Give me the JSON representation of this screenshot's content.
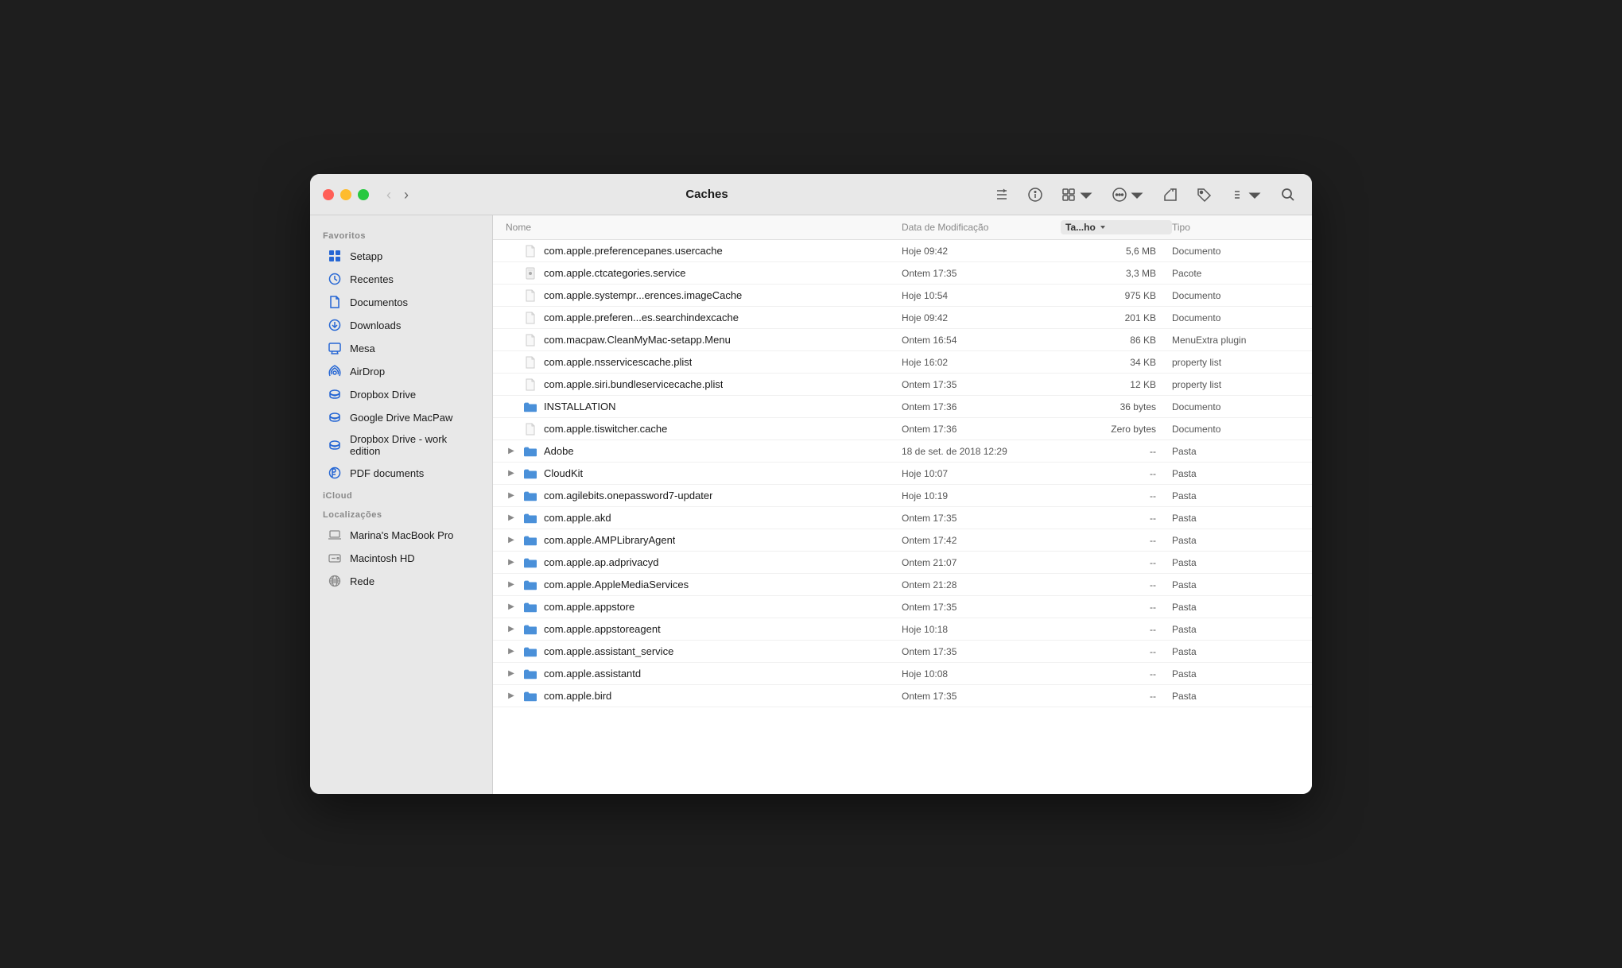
{
  "window": {
    "title": "Caches"
  },
  "toolbar": {
    "back_label": "‹",
    "forward_label": "›",
    "title": "Caches"
  },
  "sidebar": {
    "sections": [
      {
        "label": "Favoritos",
        "items": [
          {
            "id": "setapp",
            "icon": "setapp-icon",
            "label": "Setapp",
            "icon_type": "grid"
          },
          {
            "id": "recentes",
            "icon": "recent-icon",
            "label": "Recentes",
            "icon_type": "clock"
          },
          {
            "id": "documentos",
            "icon": "doc-icon",
            "label": "Documentos",
            "icon_type": "doc"
          },
          {
            "id": "downloads",
            "icon": "download-icon",
            "label": "Downloads",
            "icon_type": "arrow-down"
          },
          {
            "id": "mesa",
            "icon": "desktop-icon",
            "label": "Mesa",
            "icon_type": "monitor"
          },
          {
            "id": "airdrop",
            "icon": "airdrop-icon",
            "label": "AirDrop",
            "icon_type": "airdrop"
          },
          {
            "id": "dropbox",
            "icon": "dropbox-icon",
            "label": "Dropbox Drive",
            "icon_type": "hdd"
          },
          {
            "id": "googledrive",
            "icon": "googledrive-icon",
            "label": "Google Drive MacPaw",
            "icon_type": "hdd"
          },
          {
            "id": "dropbox-work",
            "icon": "dropbox-work-icon",
            "label": "Dropbox Drive - work edition",
            "icon_type": "hdd"
          },
          {
            "id": "pdf",
            "icon": "pdf-icon",
            "label": "PDF documents",
            "icon_type": "gear"
          }
        ]
      },
      {
        "label": "iCloud",
        "items": []
      },
      {
        "label": "Localizações",
        "items": [
          {
            "id": "macbook",
            "icon": "laptop-icon",
            "label": "Marina's MacBook Pro",
            "icon_type": "laptop"
          },
          {
            "id": "macintosh",
            "icon": "hd-icon",
            "label": "Macintosh HD",
            "icon_type": "hd"
          },
          {
            "id": "rede",
            "icon": "network-icon",
            "label": "Rede",
            "icon_type": "globe"
          }
        ]
      }
    ]
  },
  "columns": {
    "name": "Nome",
    "date": "Data de Modificação",
    "size": "Ta...ho",
    "type": "Tipo"
  },
  "files": [
    {
      "name": "com.apple.preferencepanes.usercache",
      "date": "Hoje 09:42",
      "size": "5,6 MB",
      "type": "Documento",
      "kind": "doc",
      "folder": false,
      "expandable": false
    },
    {
      "name": "com.apple.ctcategories.service",
      "date": "Ontem 17:35",
      "size": "3,3 MB",
      "type": "Pacote",
      "kind": "pkg",
      "folder": false,
      "expandable": false
    },
    {
      "name": "com.apple.systempr...erences.imageCache",
      "date": "Hoje 10:54",
      "size": "975 KB",
      "type": "Documento",
      "kind": "doc",
      "folder": false,
      "expandable": false
    },
    {
      "name": "com.apple.preferen...es.searchindexcache",
      "date": "Hoje 09:42",
      "size": "201 KB",
      "type": "Documento",
      "kind": "doc",
      "folder": false,
      "expandable": false
    },
    {
      "name": "com.macpaw.CleanMyMac-setapp.Menu",
      "date": "Ontem 16:54",
      "size": "86 KB",
      "type": "MenuExtra plugin",
      "kind": "doc",
      "folder": false,
      "expandable": false
    },
    {
      "name": "com.apple.nsservicescache.plist",
      "date": "Hoje 16:02",
      "size": "34 KB",
      "type": "property list",
      "kind": "doc",
      "folder": false,
      "expandable": false
    },
    {
      "name": "com.apple.siri.bundleservicecache.plist",
      "date": "Ontem 17:35",
      "size": "12 KB",
      "type": "property list",
      "kind": "doc",
      "folder": false,
      "expandable": false
    },
    {
      "name": "INSTALLATION",
      "date": "Ontem 17:36",
      "size": "36 bytes",
      "type": "Documento",
      "kind": "folder",
      "folder": true,
      "expandable": false
    },
    {
      "name": "com.apple.tiswitcher.cache",
      "date": "Ontem 17:36",
      "size": "Zero bytes",
      "type": "Documento",
      "kind": "doc",
      "folder": false,
      "expandable": false
    },
    {
      "name": "Adobe",
      "date": "18 de set. de 2018 12:29",
      "size": "--",
      "type": "Pasta",
      "kind": "folder",
      "folder": true,
      "expandable": true
    },
    {
      "name": "CloudKit",
      "date": "Hoje 10:07",
      "size": "--",
      "type": "Pasta",
      "kind": "folder",
      "folder": true,
      "expandable": true
    },
    {
      "name": "com.agilebits.onepassword7-updater",
      "date": "Hoje 10:19",
      "size": "--",
      "type": "Pasta",
      "kind": "folder",
      "folder": true,
      "expandable": true
    },
    {
      "name": "com.apple.akd",
      "date": "Ontem 17:35",
      "size": "--",
      "type": "Pasta",
      "kind": "folder",
      "folder": true,
      "expandable": true
    },
    {
      "name": "com.apple.AMPLibraryAgent",
      "date": "Ontem 17:42",
      "size": "--",
      "type": "Pasta",
      "kind": "folder",
      "folder": true,
      "expandable": true
    },
    {
      "name": "com.apple.ap.adprivacyd",
      "date": "Ontem 21:07",
      "size": "--",
      "type": "Pasta",
      "kind": "folder",
      "folder": true,
      "expandable": true
    },
    {
      "name": "com.apple.AppleMediaServices",
      "date": "Ontem 21:28",
      "size": "--",
      "type": "Pasta",
      "kind": "folder",
      "folder": true,
      "expandable": true
    },
    {
      "name": "com.apple.appstore",
      "date": "Ontem 17:35",
      "size": "--",
      "type": "Pasta",
      "kind": "folder",
      "folder": true,
      "expandable": true
    },
    {
      "name": "com.apple.appstoreagent",
      "date": "Hoje 10:18",
      "size": "--",
      "type": "Pasta",
      "kind": "folder",
      "folder": true,
      "expandable": true
    },
    {
      "name": "com.apple.assistant_service",
      "date": "Ontem 17:35",
      "size": "--",
      "type": "Pasta",
      "kind": "folder",
      "folder": true,
      "expandable": true
    },
    {
      "name": "com.apple.assistantd",
      "date": "Hoje 10:08",
      "size": "--",
      "type": "Pasta",
      "kind": "folder",
      "folder": true,
      "expandable": true
    },
    {
      "name": "com.apple.bird",
      "date": "Ontem 17:35",
      "size": "--",
      "type": "Pasta",
      "kind": "folder",
      "folder": true,
      "expandable": true
    }
  ]
}
